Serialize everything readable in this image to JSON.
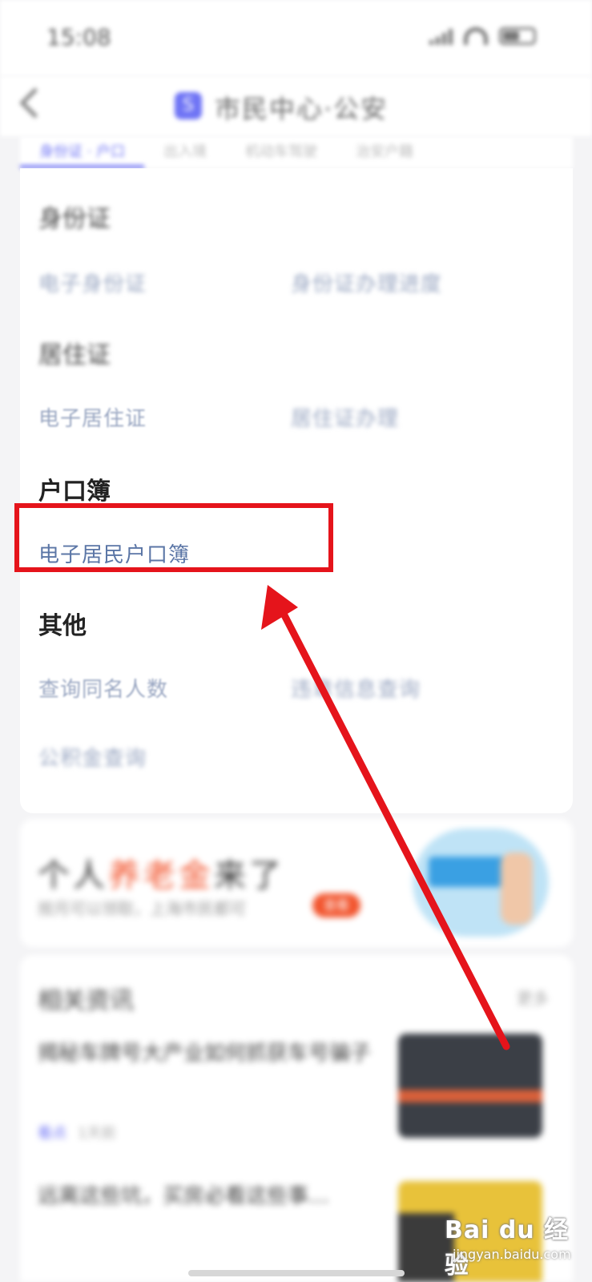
{
  "status_bar": {
    "time": "15:08"
  },
  "header": {
    "back_icon": "chevron-left-icon",
    "app_icon_letter": "S",
    "title": "市民中心·公安"
  },
  "tabs": [
    {
      "label": "身份证 · 户口",
      "active": true
    },
    {
      "label": "出入境",
      "active": false
    },
    {
      "label": "机动车驾驶",
      "active": false
    },
    {
      "label": "治安户籍",
      "active": false
    }
  ],
  "sections": {
    "idcard": {
      "title": "身份证",
      "items": [
        "电子身份证",
        "身份证办理进度"
      ]
    },
    "residence": {
      "title": "居住证",
      "items": [
        "电子居住证",
        "居住证办理"
      ]
    },
    "hukou": {
      "title": "户口簿",
      "items": [
        "电子居民户口簿"
      ]
    },
    "other": {
      "title": "其他",
      "items": [
        "查询同名人数",
        "违章信息查询",
        "公积金查询"
      ]
    }
  },
  "banner": {
    "headline_pre": "个人",
    "headline_accent": "养老金",
    "headline_post": "来了",
    "subtitle": "按月可以领取，上海市民都可",
    "badge": "查看"
  },
  "news": {
    "title": "相关资讯",
    "more": "更多",
    "items": [
      {
        "headline": "揭秘车牌号大产业如何抓获车号骗子",
        "source": "看点",
        "meta": "1天前"
      },
      {
        "headline": "远离这些坑，买房必看这些事…",
        "source": "",
        "meta": ""
      }
    ]
  },
  "watermark": {
    "logo": "Bai du 经验",
    "url": "jingyan.baidu.com"
  },
  "colors": {
    "highlight": "#e5141b",
    "arrow": "#e5141b",
    "accent": "#6f74f5",
    "link": "#5b76a6"
  }
}
